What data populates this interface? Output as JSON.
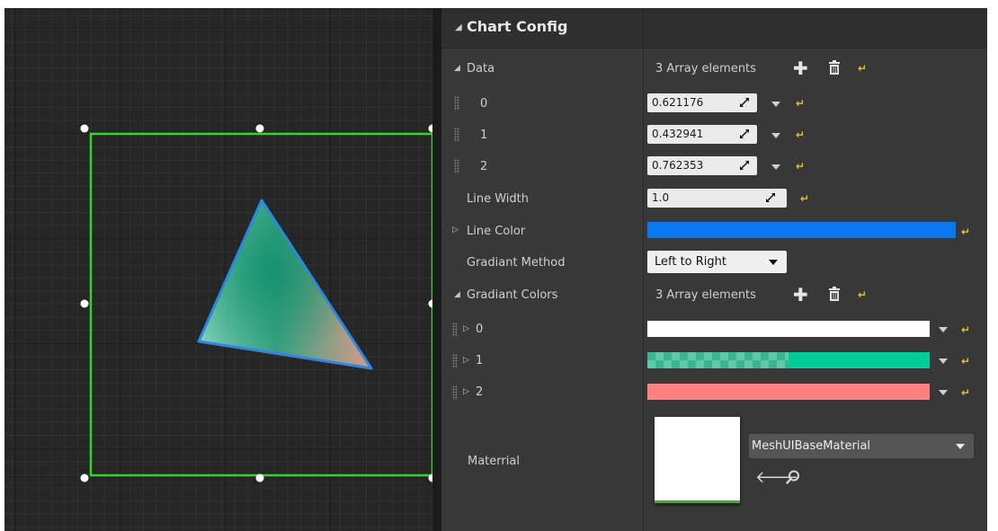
{
  "details": {
    "category": "Chart Config",
    "data": {
      "label": "Data",
      "summary": "3 Array elements",
      "elements": [
        {
          "index": "0",
          "value": "0.621176"
        },
        {
          "index": "1",
          "value": "0.432941"
        },
        {
          "index": "2",
          "value": "0.762353"
        }
      ]
    },
    "line_width": {
      "label": "Line Width",
      "value": "1.0"
    },
    "line_color": {
      "label": "Line Color",
      "color": "#0a78f0"
    },
    "gradiant_method": {
      "label": "Gradiant Method",
      "value": "Left to Right"
    },
    "gradiant_colors": {
      "label": "Gradiant Colors",
      "summary": "3 Array elements",
      "elements": [
        {
          "index": "0",
          "color": "#ffffff",
          "alpha": 1.0
        },
        {
          "index": "1",
          "color": "#00cc99",
          "alpha": 0.5
        },
        {
          "index": "2",
          "color": "#ff8080",
          "alpha": 1.0
        }
      ]
    },
    "material": {
      "label": "Materrial",
      "asset": "MeshUIBaseMaterial"
    }
  },
  "icons": {
    "expand": "triangle-expand-icon",
    "collapse": "triangle-collapse-icon",
    "add": "plus-icon",
    "delete": "trash-icon",
    "reset": "reset-to-default-icon",
    "use_selected": "arrow-left-icon",
    "browse": "search-icon"
  },
  "colors": {
    "selection_box": "#35d42c",
    "triangle_outline": "#2f86e0",
    "panel_bg": "#383838",
    "header_bg": "#2f2f2f"
  }
}
